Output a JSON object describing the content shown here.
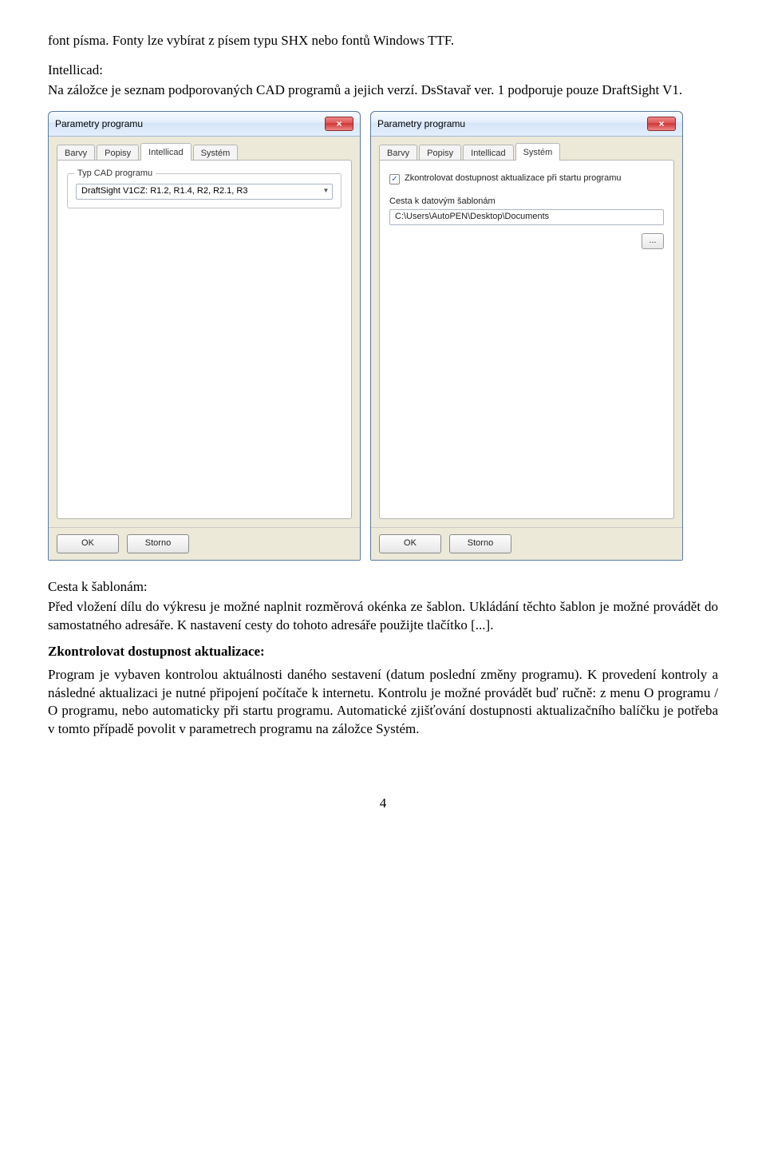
{
  "para1": "font písma. Fonty lze vybírat z písem typu SHX nebo fontů Windows TTF.",
  "intellicad_label": "Intellicad:",
  "para2": "Na záložce je seznam podporovaných CAD programů a jejich verzí. DsStavař ver. 1 podporuje pouze DraftSight V1.",
  "dialog1": {
    "title": "Parametry programu",
    "close": "×",
    "tabs": [
      "Barvy",
      "Popisy",
      "Intellicad",
      "Systém"
    ],
    "active_tab": 2,
    "group_legend": "Typ CAD programu",
    "combo_value": "DraftSight V1CZ: R1.2, R1.4, R2, R2.1, R3",
    "ok": "OK",
    "storno": "Storno"
  },
  "dialog2": {
    "title": "Parametry programu",
    "close": "×",
    "tabs": [
      "Barvy",
      "Popisy",
      "Intellicad",
      "Systém"
    ],
    "active_tab": 3,
    "chk_label": "Zkontrolovat dostupnost aktualizace při startu programu",
    "chk_checked": true,
    "path_label": "Cesta k datovým šablonám",
    "path_value": "C:\\Users\\AutoPEN\\Desktop\\Documents",
    "browse": "...",
    "ok": "OK",
    "storno": "Storno"
  },
  "cesta_label": "Cesta k šablonám:",
  "para3": "Před vložení dílu do výkresu je možné naplnit rozměrová okénka ze šablon. Ukládání těchto šablon je možné provádět do samostatného adresáře. K nastavení cesty do tohoto adresáře použijte tlačítko [...].",
  "zkontrolovat_label": "Zkontrolovat dostupnost aktualizace:",
  "para4": "Program je vybaven kontrolou aktuálnosti daného sestavení (datum poslední změny programu). K provedení kontroly a následné aktualizaci je nutné připojení počítače k internetu. Kontrolu je možné provádět buď ručně: z menu O programu / O programu, nebo automaticky při startu programu. Automatické zjišťování dostupnosti aktualizačního balíčku je potřeba v tomto případě povolit v parametrech programu na záložce Systém.",
  "page_number": "4"
}
